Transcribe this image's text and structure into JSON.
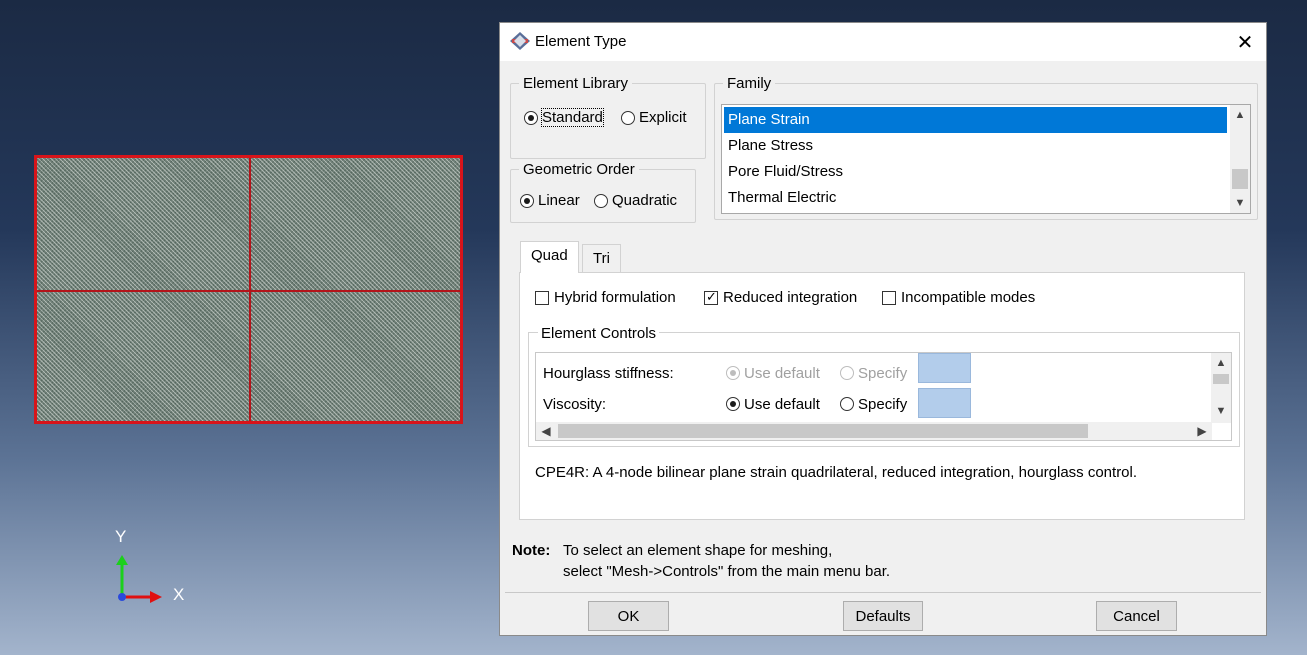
{
  "viewport": {
    "triad": {
      "y_label": "Y",
      "x_label": "X"
    }
  },
  "dialog": {
    "title": "Element Type",
    "element_library": {
      "label": "Element Library",
      "options": [
        "Standard",
        "Explicit"
      ],
      "selected": "Standard"
    },
    "geometric_order": {
      "label": "Geometric Order",
      "options": [
        "Linear",
        "Quadratic"
      ],
      "selected": "Linear"
    },
    "family": {
      "label": "Family",
      "items": [
        "Plane Strain",
        "Plane Stress",
        "Pore Fluid/Stress",
        "Thermal Electric"
      ],
      "selected": "Plane Strain"
    },
    "tabs": [
      "Quad",
      "Tri"
    ],
    "active_tab": "Quad",
    "options": {
      "hybrid": {
        "label": "Hybrid formulation",
        "checked": false
      },
      "reduced": {
        "label": "Reduced integration",
        "checked": true
      },
      "incompatible": {
        "label": "Incompatible modes",
        "checked": false
      }
    },
    "element_controls": {
      "label": "Element Controls",
      "rows": [
        {
          "label": "Hourglass stiffness:",
          "opt1": "Use default",
          "opt2": "Specify",
          "enabled": false
        },
        {
          "label": "Viscosity:",
          "opt1": "Use default",
          "opt2": "Specify",
          "enabled": true
        }
      ]
    },
    "description": "CPE4R:  A 4-node bilinear plane strain quadrilateral, reduced integration, hourglass control.",
    "note": {
      "label": "Note:",
      "line1": "To select an element shape for meshing,",
      "line2": "select \"Mesh->Controls\" from the main menu bar."
    },
    "buttons": {
      "ok": "OK",
      "defaults": "Defaults",
      "cancel": "Cancel"
    },
    "colors": {
      "selection": "#0078d7",
      "swatch": "#b3cdeb",
      "mesh_border": "#d8141a"
    }
  }
}
